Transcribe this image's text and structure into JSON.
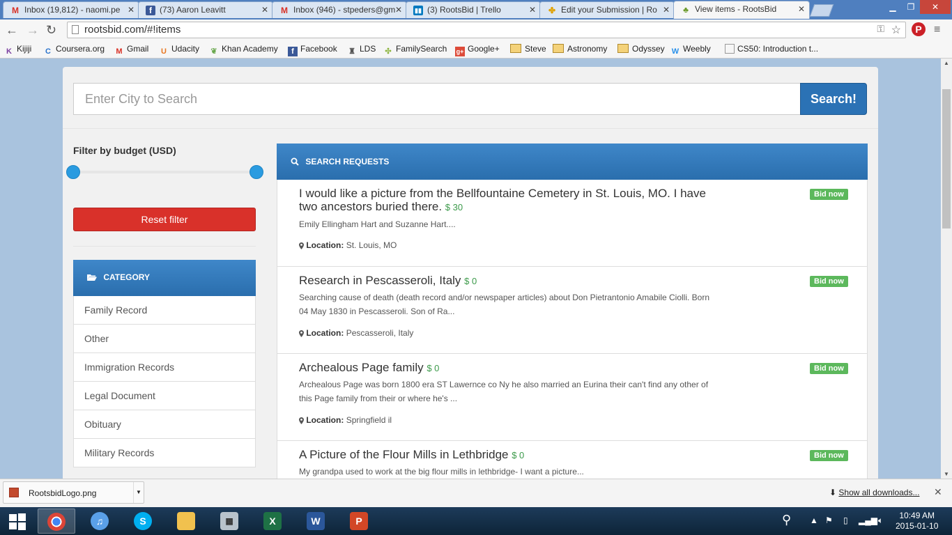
{
  "browser": {
    "tabs": [
      {
        "title": "Inbox (19,812) - naomi.pe",
        "favicon": "gmail-icon",
        "active": false
      },
      {
        "title": "(73) Aaron Leavitt",
        "favicon": "facebook-icon",
        "active": false
      },
      {
        "title": "Inbox (946) - stpeders@gm",
        "favicon": "gmail-icon",
        "active": false
      },
      {
        "title": "(3) RootsBid | Trello",
        "favicon": "trello-icon",
        "active": false
      },
      {
        "title": "Edit your Submission | Ro",
        "favicon": "pinwheel-icon",
        "active": false
      },
      {
        "title": "View items - RootsBid",
        "favicon": "rootsbid-icon",
        "active": true
      }
    ],
    "url": "rootsbid.com/#!items",
    "bookmarks": [
      {
        "label": "Kijiji",
        "type": "site"
      },
      {
        "label": "Coursera.org",
        "type": "site"
      },
      {
        "label": "Gmail",
        "type": "site"
      },
      {
        "label": "Udacity",
        "type": "site"
      },
      {
        "label": "Khan Academy",
        "type": "site"
      },
      {
        "label": "Facebook",
        "type": "site"
      },
      {
        "label": "LDS",
        "type": "site"
      },
      {
        "label": "FamilySearch",
        "type": "site"
      },
      {
        "label": "Google+",
        "type": "site"
      },
      {
        "label": "Steve",
        "type": "folder"
      },
      {
        "label": "Astronomy",
        "type": "folder"
      },
      {
        "label": "Odyssey",
        "type": "folder"
      },
      {
        "label": "Weebly",
        "type": "site"
      },
      {
        "label": "CS50: Introduction t...",
        "type": "site"
      }
    ]
  },
  "search": {
    "placeholder": "Enter City to Search",
    "button": "Search!"
  },
  "filter": {
    "title": "Filter by budget (USD)",
    "reset_label": "Reset filter"
  },
  "category": {
    "header": "CATEGORY",
    "items": [
      "Family Record",
      "Other",
      "Immigration Records",
      "Legal Document",
      "Obituary",
      "Military Records"
    ]
  },
  "requests": {
    "header": "SEARCH REQUESTS",
    "location_label": "Location:",
    "bid_label": "Bid now",
    "items": [
      {
        "title": "I would like a picture from the Bellfountaine Cemetery in St. Louis, MO. I have two ancestors buried there.",
        "price": "$ 30",
        "description": "Emily Ellingham Hart and Suzanne Hart....",
        "location": "St. Louis, MO"
      },
      {
        "title": "Research in Pescasseroli, Italy",
        "price": "$ 0",
        "description": "Searching cause of death (death record and/or newspaper articles) about Don Pietrantonio Amabile Ciolli. Born 04 May 1830 in Pescasseroli. Son of Ra...",
        "location": "Pescasseroli, Italy"
      },
      {
        "title": "Archealous Page family",
        "price": "$ 0",
        "description": "Archealous Page was born 1800 era ST Lawernce co Ny he also married an Eurina their can't find any other of this Page family from their or where he's ...",
        "location": "Springfield il"
      },
      {
        "title": "A Picture of the Flour Mills in Lethbridge",
        "price": "$ 0",
        "description": "My grandpa used to work at the big flour mills in lethbridge- I want a picture...",
        "location": ""
      }
    ]
  },
  "downloads": {
    "file": "RootsbidLogo.png",
    "show_all": "Show all downloads..."
  },
  "taskbar": {
    "time": "10:49 AM",
    "date": "2015-01-10",
    "apps": [
      "chrome",
      "itunes",
      "skype",
      "explorer",
      "calculator",
      "excel",
      "word",
      "powerpoint"
    ]
  },
  "colors": {
    "primary": "#2b72b5",
    "danger": "#d9312a",
    "success": "#5cb85c",
    "price": "#3c9a4a"
  }
}
